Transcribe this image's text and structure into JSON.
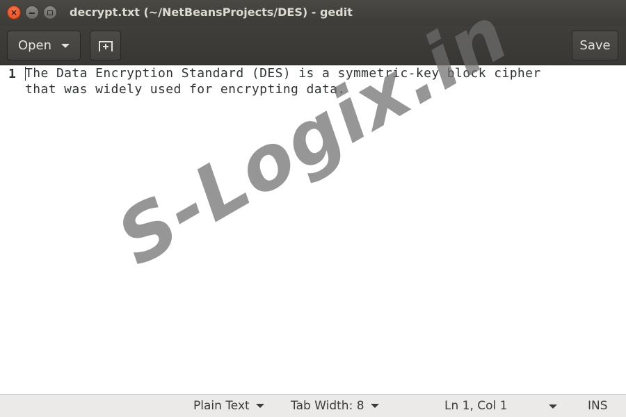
{
  "window": {
    "title": "decrypt.txt (~/NetBeansProjects/DES) - gedit"
  },
  "titlebar": {
    "close_glyph": "×"
  },
  "headerbar": {
    "open_label": "Open",
    "save_label": "Save",
    "new_tab_icon": "new-tab-icon"
  },
  "editor": {
    "line_number": "1",
    "lines": [
      "The Data Encryption Standard (DES) is a symmetric-key block cipher",
      "that was widely used for encrypting data."
    ]
  },
  "watermark": {
    "text": "S-Logix.in"
  },
  "statusbar": {
    "language": "Plain Text",
    "tab_width": "Tab Width: 8",
    "position": "Ln 1, Col 1",
    "mode": "INS"
  },
  "colors": {
    "titlebar_bg": "#3c3b37",
    "close_button": "#e0461b",
    "statusbar_bg": "#ebeae8",
    "text": "#2e3436"
  }
}
